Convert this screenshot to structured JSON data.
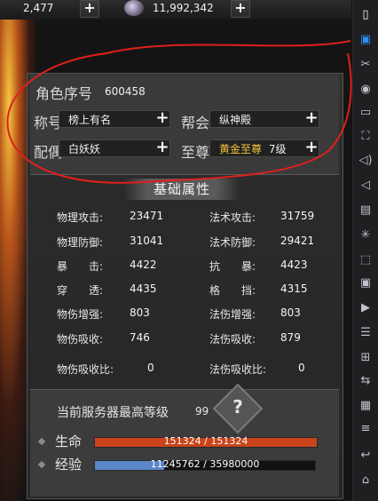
{
  "resources": {
    "res1_value": "2,477",
    "res2_value": "11,992,342",
    "plus": "+"
  },
  "profile": {
    "serial_label": "角色序号",
    "serial_value": "600458",
    "title_label": "称号",
    "title_value": "榜上有名",
    "guild_label": "帮会",
    "guild_value": "纵神殿",
    "spouse_label": "配偶",
    "spouse_value": "白妖妖",
    "supreme_label": "至尊",
    "supreme_value": "黄金至尊",
    "supreme_level": "7级"
  },
  "attributes": {
    "header": "基础属性",
    "stats": [
      {
        "label": "物理攻击:",
        "value": "23471"
      },
      {
        "label": "法术攻击:",
        "value": "31759"
      },
      {
        "label": "物理防御:",
        "value": "31041"
      },
      {
        "label": "法术防御:",
        "value": "29421"
      },
      {
        "label": "暴　　击:",
        "value": "4422"
      },
      {
        "label": "抗　　暴:",
        "value": "4423"
      },
      {
        "label": "穿　　透:",
        "value": "4435"
      },
      {
        "label": "格　　挡:",
        "value": "4315"
      },
      {
        "label": "物伤增强:",
        "value": "803"
      },
      {
        "label": "法伤增强:",
        "value": "803"
      },
      {
        "label": "物伤吸收:",
        "value": "746"
      },
      {
        "label": "法伤吸收:",
        "value": "879"
      },
      {
        "label": "物伤吸收比:",
        "value": "0"
      },
      {
        "label": "法伤吸收比:",
        "value": "0"
      }
    ]
  },
  "server": {
    "max_level_label": "当前服务器最高等级",
    "max_level_value": "99",
    "help": "?"
  },
  "bars": {
    "hp_label": "生命",
    "hp_text": "151324 / 151324",
    "hp_fraction": 1.0,
    "exp_label": "经验",
    "exp_text": "11245762 / 35980000",
    "exp_fraction": 0.3125
  },
  "colors": {
    "hp": "#c9441b",
    "exp": "#5b86c9",
    "annotation": "#e0201c",
    "gold": "#f3c23b"
  }
}
